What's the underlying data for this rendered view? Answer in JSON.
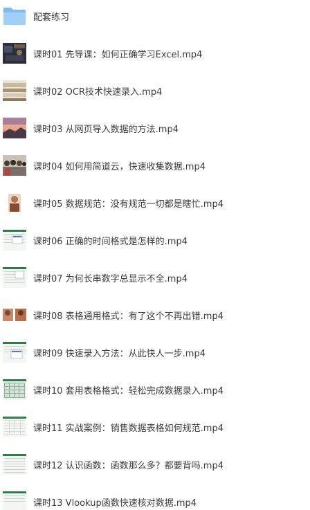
{
  "folder": {
    "name": "配套练习",
    "icon": "folder-icon",
    "color": "#8dc5f0"
  },
  "files": [
    {
      "name": "课时01 先导课：如何正确学习Excel.mp4",
      "thumb": "video-thumb-dark-icon"
    },
    {
      "name": "课时02 OCR技术快速录入.mp4",
      "thumb": "video-thumb-papers-icon"
    },
    {
      "name": "课时03 从网页导入数据的方法.mp4",
      "thumb": "video-thumb-sunset-icon"
    },
    {
      "name": "课时04 如何用简道云，快速收集数据.mp4",
      "thumb": "video-thumb-crowd-icon"
    },
    {
      "name": "课时05 数据规范：没有规范一切都是瞎忙.mp4",
      "thumb": "video-thumb-people-icon"
    },
    {
      "name": "课时06 正确的时间格式是怎样的.mp4",
      "thumb": "video-thumb-spreadsheet-icon"
    },
    {
      "name": "课时07 为何长串数字总显示不全.mp4",
      "thumb": "video-thumb-spreadsheet-icon"
    },
    {
      "name": "课时08 表格通用格式：有了这个不再出错.mp4",
      "thumb": "video-thumb-faces-icon"
    },
    {
      "name": "课时09 快速录入方法：从此快人一步.mp4",
      "thumb": "video-thumb-spreadsheet-icon"
    },
    {
      "name": "课时10 套用表格格式：轻松完成数据录入.mp4",
      "thumb": "video-thumb-grid-icon"
    },
    {
      "name": "课时11 实战案例：销售数据表格如何规范.mp4",
      "thumb": "video-thumb-grid-icon"
    },
    {
      "name": "课时12 认识函数：函数那么多？都要背吗.mp4",
      "thumb": "video-thumb-spreadsheet-icon"
    },
    {
      "name": "课时13 Vlookup函数快速核对数据.mp4",
      "thumb": "video-thumb-spreadsheet-icon"
    }
  ]
}
